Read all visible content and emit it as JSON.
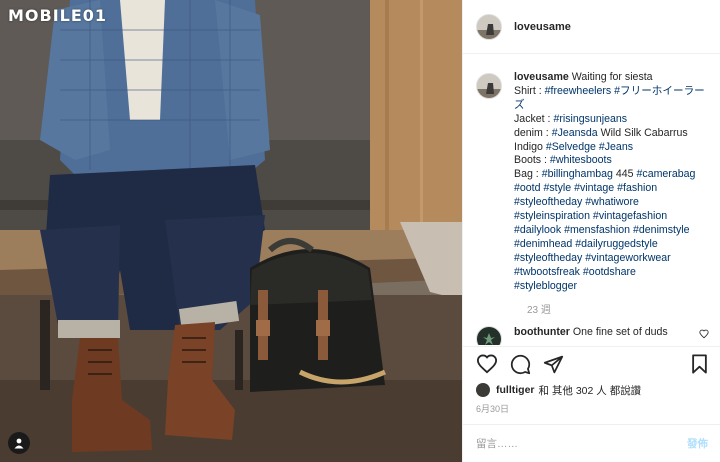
{
  "watermark": {
    "text": "MOBILE01"
  },
  "post": {
    "username": "loveusame",
    "caption": {
      "username": "loveusame",
      "lines": [
        [
          {
            "t": "Waiting for siesta",
            "k": "text"
          }
        ],
        [
          {
            "t": "Shirt : ",
            "k": "text"
          },
          {
            "t": "#freewheelers",
            "k": "tag"
          },
          {
            "t": " ",
            "k": "text"
          },
          {
            "t": "#フリーホイーラーズ",
            "k": "tag"
          }
        ],
        [
          {
            "t": "Jacket : ",
            "k": "text"
          },
          {
            "t": "#risingsunjeans",
            "k": "tag"
          }
        ],
        [
          {
            "t": "denim : ",
            "k": "text"
          },
          {
            "t": "#Jeansda",
            "k": "tag"
          },
          {
            "t": " Wild Silk Cabarrus",
            "k": "text"
          }
        ],
        [
          {
            "t": "Indigo ",
            "k": "text"
          },
          {
            "t": "#Selvedge",
            "k": "tag"
          },
          {
            "t": " ",
            "k": "text"
          },
          {
            "t": "#Jeans",
            "k": "tag"
          }
        ],
        [
          {
            "t": "Boots : ",
            "k": "text"
          },
          {
            "t": "#whitesboots",
            "k": "tag"
          }
        ],
        [
          {
            "t": "Bag : ",
            "k": "text"
          },
          {
            "t": "#billinghambag",
            "k": "tag"
          },
          {
            "t": " 445 ",
            "k": "text"
          },
          {
            "t": "#camerabag",
            "k": "tag"
          }
        ],
        [
          {
            "t": "#ootd",
            "k": "tag"
          },
          {
            "t": " ",
            "k": "text"
          },
          {
            "t": "#style",
            "k": "tag"
          },
          {
            "t": " ",
            "k": "text"
          },
          {
            "t": "#vintage",
            "k": "tag"
          },
          {
            "t": " ",
            "k": "text"
          },
          {
            "t": "#fashion",
            "k": "tag"
          }
        ],
        [
          {
            "t": "#styleoftheday",
            "k": "tag"
          },
          {
            "t": " ",
            "k": "text"
          },
          {
            "t": "#whatiwore",
            "k": "tag"
          }
        ],
        [
          {
            "t": "#styleinspiration",
            "k": "tag"
          },
          {
            "t": " ",
            "k": "text"
          },
          {
            "t": "#vintagefashion",
            "k": "tag"
          }
        ],
        [
          {
            "t": "#dailylook",
            "k": "tag"
          },
          {
            "t": " ",
            "k": "text"
          },
          {
            "t": "#mensfashion",
            "k": "tag"
          },
          {
            "t": " ",
            "k": "text"
          },
          {
            "t": "#denimstyle",
            "k": "tag"
          }
        ],
        [
          {
            "t": "#denimhead",
            "k": "tag"
          },
          {
            "t": " ",
            "k": "text"
          },
          {
            "t": "#dailyruggedstyle",
            "k": "tag"
          }
        ],
        [
          {
            "t": "#styleoftheday",
            "k": "tag"
          },
          {
            "t": " ",
            "k": "text"
          },
          {
            "t": "#vintageworkwear",
            "k": "tag"
          }
        ],
        [
          {
            "t": "#twbootsfreak",
            "k": "tag"
          },
          {
            "t": " ",
            "k": "text"
          },
          {
            "t": "#ootdshare",
            "k": "tag"
          }
        ],
        [
          {
            "t": "#styleblogger",
            "k": "tag"
          }
        ]
      ],
      "time": "23 週"
    },
    "comment": {
      "username": "boothunter",
      "text": "One fine set of duds"
    },
    "likes": {
      "username": "fulltiger",
      "rest": "和 其他 302 人 都說讚"
    },
    "date": "6月30日",
    "add_comment": {
      "placeholder": "留言……",
      "post_label": "發佈"
    }
  },
  "icons": [
    "heart-icon",
    "comment-icon",
    "share-icon",
    "bookmark-icon",
    "user-tag-icon"
  ]
}
